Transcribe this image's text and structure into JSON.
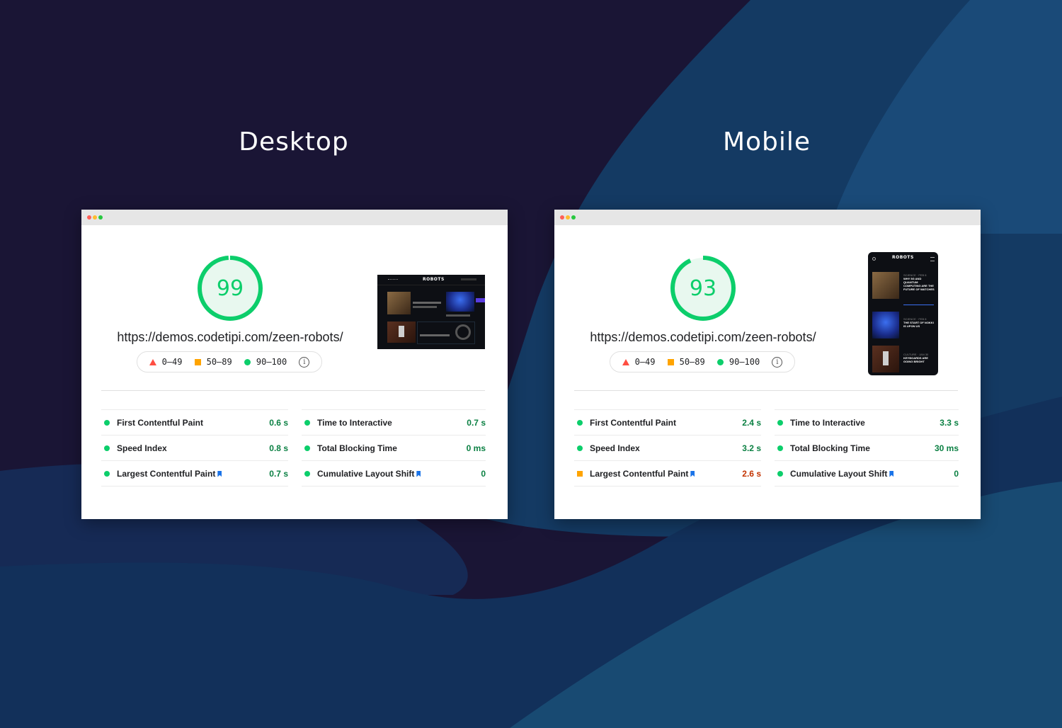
{
  "headings": {
    "desktop": "Desktop",
    "mobile": "Mobile"
  },
  "colors": {
    "good": "#0cce6b",
    "average": "#ffa400",
    "poor": "#ff4e42"
  },
  "legend": {
    "poor": "0–49",
    "average": "50–89",
    "good": "90–100",
    "info_icon": "info-icon"
  },
  "desktop": {
    "score": "99",
    "score_value": 99,
    "url": "https://demos.codetipi.com/zeen-robots/",
    "metrics_left": [
      {
        "name": "First Contentful Paint",
        "value": "0.6 s",
        "status": "good"
      },
      {
        "name": "Speed Index",
        "value": "0.8 s",
        "status": "good"
      },
      {
        "name": "Largest Contentful Paint",
        "value": "0.7 s",
        "status": "good"
      }
    ],
    "metrics_right": [
      {
        "name": "Time to Interactive",
        "value": "0.7 s",
        "status": "good"
      },
      {
        "name": "Total Blocking Time",
        "value": "0 ms",
        "status": "good"
      },
      {
        "name": "Cumulative Layout Shift",
        "value": "0",
        "status": "good"
      }
    ],
    "thumbnail": {
      "logo": "ROBOTS"
    }
  },
  "mobile": {
    "score": "93",
    "score_value": 93,
    "url": "https://demos.codetipi.com/zeen-robots/",
    "metrics_left": [
      {
        "name": "First Contentful Paint",
        "value": "2.4 s",
        "status": "good"
      },
      {
        "name": "Speed Index",
        "value": "3.2 s",
        "status": "good"
      },
      {
        "name": "Largest Contentful Paint",
        "value": "2.6 s",
        "status": "average"
      }
    ],
    "metrics_right": [
      {
        "name": "Time to Interactive",
        "value": "3.3 s",
        "status": "good"
      },
      {
        "name": "Total Blocking Time",
        "value": "30 ms",
        "status": "good"
      },
      {
        "name": "Cumulative Layout Shift",
        "value": "0",
        "status": "good"
      }
    ],
    "thumbnail": {
      "logo": "ROBOTS",
      "posts": [
        {
          "meta": "SCIENCE · FEB 8",
          "title": "WHY 5G AND QUANTUM COMPUTING ARE THE FUTURE OF WATCHES"
        },
        {
          "meta": "SCIENCE · FEB 8",
          "title": "THE START OF NOKKI IS UPON US"
        },
        {
          "meta": "CULTURE · JAN 30",
          "title": "KEYBOARDS ARE GOING BRIGHT"
        }
      ]
    }
  }
}
